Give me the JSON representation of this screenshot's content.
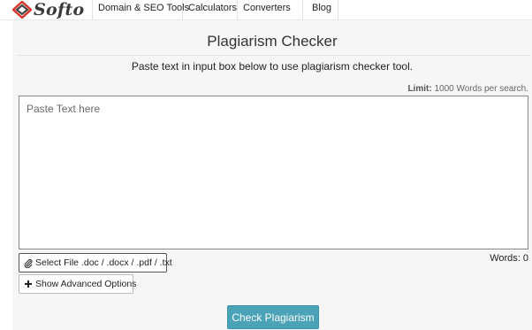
{
  "brand": {
    "logo_text": "Softo",
    "accent": "#d9342b"
  },
  "nav": {
    "items": [
      {
        "label": "Domain & SEO Tools"
      },
      {
        "label": "Calculators"
      },
      {
        "label": "Converters"
      },
      {
        "label": "Blog"
      }
    ]
  },
  "main": {
    "title": "Plagiarism Checker",
    "subtitle": "Paste text in input box below to use plagiarism checker tool.",
    "limit_label": "Limit:",
    "limit_value": "1000 Words per search.",
    "input": {
      "placeholder": "Paste Text here",
      "value": ""
    },
    "words_count": "Words: 0",
    "select_file_label": "Select File .doc / .docx / .pdf / .txt",
    "advanced_label": "Show Advanced Options",
    "check_button_label": "Check Plagiarism",
    "check_button_color": "#4aa3b6"
  },
  "icons": {
    "file": "paperclip-icon",
    "advanced": "plus-icon"
  }
}
